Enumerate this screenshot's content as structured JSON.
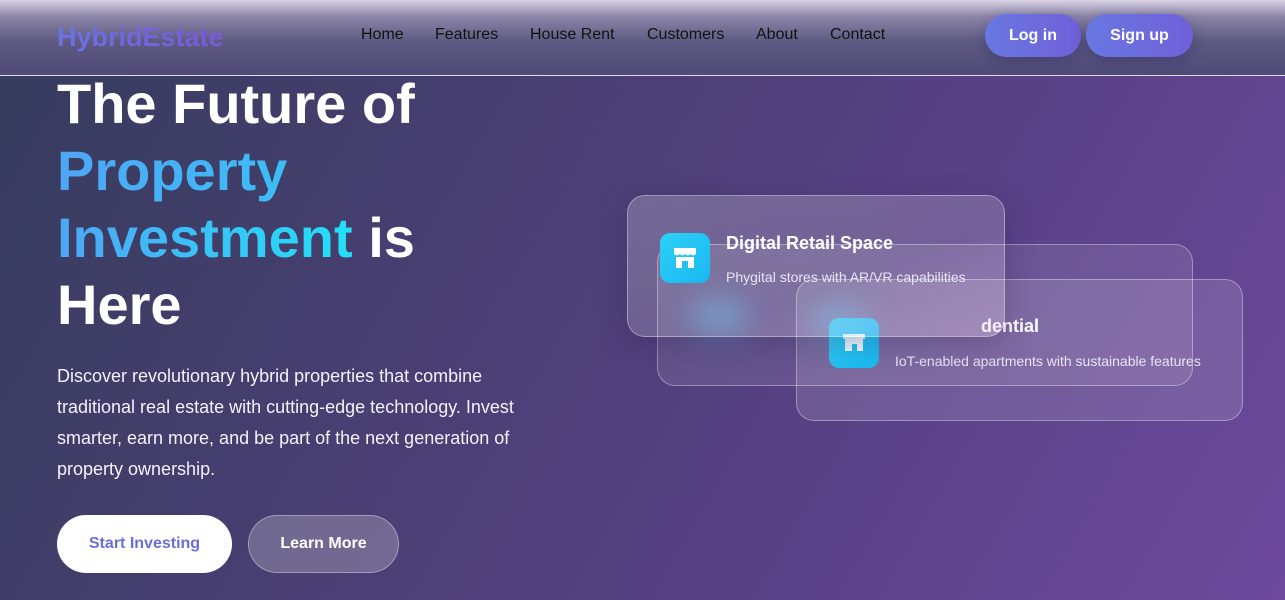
{
  "header": {
    "logo": "HybridEstate",
    "nav": [
      "Home",
      "Features",
      "House Rent",
      "Customers",
      "About",
      "Contact"
    ],
    "login_label": "Log in",
    "signup_label": "Sign up"
  },
  "hero": {
    "title_part1": "The Future of",
    "title_highlight1": "Property",
    "title_highlight2": "Investment",
    "title_part2": " is",
    "title_part3": "Here",
    "description": "Discover revolutionary hybrid properties that combine traditional real estate with cutting-edge technology. Invest smarter, earn more, and be part of the next generation of property ownership.",
    "start_label": "Start Investing",
    "learn_label": "Learn More"
  },
  "cards": {
    "retail": {
      "title": "Digital Retail Space",
      "subtitle": "Phygital stores with AR/VR capabilities",
      "icon": "store-icon"
    },
    "residential": {
      "title_visible": "dential",
      "subtitle": "IoT-enabled apartments with sustainable features",
      "icon": "home-icon"
    }
  },
  "colors": {
    "accent": "#6a72e6",
    "highlight": "#22e0f7",
    "icon_bg": "#2ed0f7"
  }
}
